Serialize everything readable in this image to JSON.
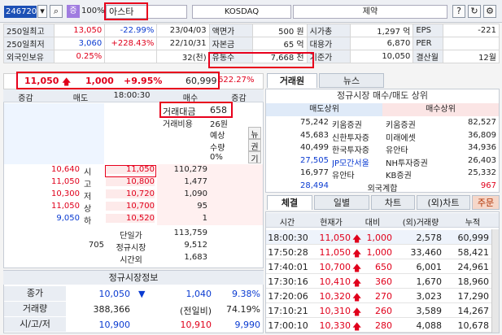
{
  "toolbar": {
    "code": "246720",
    "badge": "증",
    "percent": "100%",
    "name": "아스타",
    "market": "KOSDAQ",
    "sector": "제약",
    "help": "?",
    "refresh": "↻",
    "settings": "⚙"
  },
  "info_rows": [
    {
      "l1": "250일최고",
      "v1": "13,050",
      "p1": "-22.99%",
      "d1": "23/04/03",
      "l2": "액면가",
      "v2": "500 원",
      "l3": "시가총",
      "v3": "1,297 억",
      "l4": "EPS",
      "v4": "-221"
    },
    {
      "l1": "250일최저",
      "v1": "3,060",
      "p1": "+228.43%",
      "d1": "22/10/31",
      "l2": "자본금",
      "v2": "65 억",
      "l3": "대용가",
      "v3": "6,870",
      "l4": "PER",
      "v4": ""
    },
    {
      "l1": "외국인보유",
      "v1": "0.25%",
      "p1": "",
      "d1": "32(천)",
      "l2": "유통수",
      "v2": "7,668 천",
      "l3": "기준가",
      "v3": "10,050",
      "l4": "결산월",
      "v4": "12월"
    }
  ],
  "price_bar": {
    "price": "11,050",
    "change": "1,000",
    "rate": "+9.95%",
    "volume": "60,999",
    "ratio": "622.27%"
  },
  "orderbook": {
    "headers": [
      "증감",
      "매도",
      "18:00:30",
      "매수",
      "증감"
    ],
    "trade_amount_label": "거래대금",
    "trade_amount": "658",
    "trade_cost_label": "거래비용",
    "trade_cost": "26원",
    "expected_label": "예상",
    "qty_label": "수량",
    "zero_pct": "0%",
    "side_labels": [
      "뉴",
      "권",
      "기"
    ],
    "rows": [
      {
        "sellq": "10,640",
        "tag": "시",
        "price": "11,050",
        "buyq": "110,279"
      },
      {
        "sellq": "11,050",
        "tag": "고",
        "price": "10,800",
        "buyq": "1,477"
      },
      {
        "sellq": "10,300",
        "tag": "저",
        "price": "10,720",
        "buyq": "1,090"
      },
      {
        "sellq": "11,050",
        "tag": "상",
        "price": "10,700",
        "buyq": "95"
      },
      {
        "sellq": "9,050",
        "tag": "하",
        "price": "10,520",
        "buyq": "1"
      }
    ],
    "totals": [
      {
        "left": "",
        "label": "단일가",
        "value": "113,759"
      },
      {
        "left": "705",
        "label": "정규시장",
        "value": "9,512"
      },
      {
        "left": "",
        "label": "시간외",
        "value": "1,683"
      }
    ]
  },
  "market_info": {
    "title": "정규시장정보",
    "rows": [
      {
        "label": "종가",
        "v1": "10,050",
        "arrow": "▼",
        "v2": "1,040",
        "v3": "9.38%"
      },
      {
        "label": "거래량",
        "v1": "388,366",
        "arrow": "",
        "v2": "(전일비)",
        "v3": "74.19%"
      },
      {
        "label": "시/고/저",
        "v1": "10,900",
        "arrow": "",
        "v2": "10,910",
        "v3": "9,990"
      }
    ]
  },
  "broker_tabs": [
    "거래원",
    "뉴스"
  ],
  "broker": {
    "title": "정규시장 매수/매도 상위",
    "sell_header": "매도상위",
    "buy_header": "매수상위",
    "rows": [
      {
        "sq": "75,242",
        "sn": "키움증권",
        "bn": "키움증권",
        "bq": "82,527"
      },
      {
        "sq": "45,683",
        "sn": "신한투자증",
        "bn": "미래에셋",
        "bq": "36,809"
      },
      {
        "sq": "40,499",
        "sn": "한국투자증",
        "bn": "유안타",
        "bq": "34,936"
      },
      {
        "sq": "27,505",
        "sn": "JP모간서울",
        "bn": "NH투자증권",
        "bq": "26,403"
      },
      {
        "sq": "16,977",
        "sn": "유안타",
        "bn": "KB증권",
        "bq": "25,332"
      }
    ],
    "foreign_q": "28,494",
    "foreign_label": "외국계합",
    "foreign_b": "967"
  },
  "trade_tabs": [
    "체결",
    "일별",
    "차트",
    "(외)차트",
    "주문"
  ],
  "trades": {
    "headers": [
      "시간",
      "현재가",
      "대비",
      "(외)거래량",
      "누적"
    ],
    "rows": [
      {
        "t": "18:00:30",
        "p": "11,050",
        "d": "1,000",
        "v": "2,578",
        "c": "60,999"
      },
      {
        "t": "17:50:28",
        "p": "11,050",
        "d": "1,000",
        "v": "33,460",
        "c": "58,421"
      },
      {
        "t": "17:40:01",
        "p": "10,700",
        "d": "650",
        "v": "6,001",
        "c": "24,961"
      },
      {
        "t": "17:30:16",
        "p": "10,410",
        "d": "360",
        "v": "1,670",
        "c": "18,960"
      },
      {
        "t": "17:20:06",
        "p": "10,320",
        "d": "270",
        "v": "3,023",
        "c": "17,290"
      },
      {
        "t": "17:10:21",
        "p": "10,310",
        "d": "260",
        "v": "3,589",
        "c": "14,267"
      },
      {
        "t": "17:00:10",
        "p": "10,330",
        "d": "280",
        "v": "4,088",
        "c": "10,678"
      }
    ]
  }
}
